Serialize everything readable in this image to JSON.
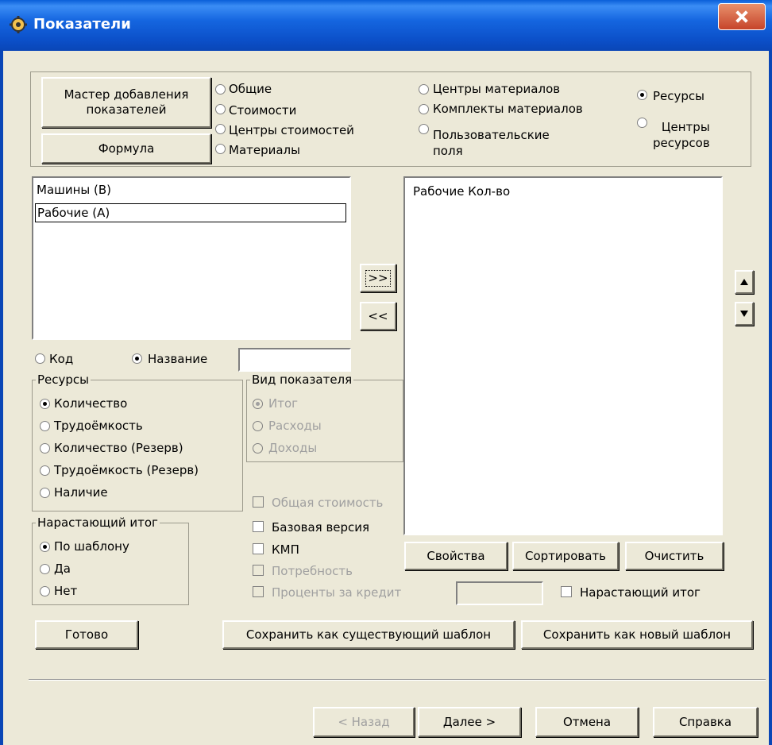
{
  "window": {
    "title": "Показатели"
  },
  "top": {
    "wizard_button": "Мастер добавления\nпоказателей",
    "formula_button": "Формула",
    "categories": [
      {
        "label": "Общие",
        "selected": false
      },
      {
        "label": "Стоимости",
        "selected": false
      },
      {
        "label": "Центры стоимостей",
        "selected": false
      },
      {
        "label": "Материалы",
        "selected": false
      },
      {
        "label": "Центры материалов",
        "selected": false
      },
      {
        "label": "Комплекты материалов",
        "selected": false
      },
      {
        "label": "Пользовательские\nполя",
        "selected": false
      },
      {
        "label": "Ресурсы",
        "selected": true
      },
      {
        "label": "Центры\nресурсов",
        "selected": false
      }
    ]
  },
  "left_list": {
    "items": [
      "Машины   (B)",
      "Рабочие   (A)"
    ]
  },
  "move_buttons": {
    "add": ">>",
    "remove": "<<"
  },
  "right_list": {
    "items": [
      "Рабочие Кол-во"
    ]
  },
  "sort": {
    "code_label": "Код",
    "name_label": "Название",
    "selected": "Название",
    "filter_value": ""
  },
  "resources_group": {
    "title": "Ресурсы",
    "options": [
      "Количество",
      "Трудоёмкость",
      "Количество (Резерв)",
      "Трудоёмкость (Резерв)",
      "Наличие"
    ],
    "selected": "Количество"
  },
  "indicator_group": {
    "title": "Вид показателя",
    "options": [
      "Итог",
      "Расходы",
      "Доходы"
    ],
    "selected": "Итог"
  },
  "cumulative_group": {
    "title": "Нарастающий итог",
    "options": [
      "По шаблону",
      "Да",
      "Нет"
    ],
    "selected": "По шаблону"
  },
  "checks": [
    {
      "label": "Общая стоимость",
      "enabled": false,
      "checked": false
    },
    {
      "label": "Базовая версия",
      "enabled": true,
      "checked": false
    },
    {
      "label": "КМП",
      "enabled": true,
      "checked": false
    },
    {
      "label": "Потребность",
      "enabled": false,
      "checked": false
    },
    {
      "label": "Проценты за кредит",
      "enabled": false,
      "checked": false
    }
  ],
  "right_buttons": {
    "properties": "Свойства",
    "sort": "Сортировать",
    "clear": "Очистить"
  },
  "cumulative_total_check": {
    "label": "Нарастающий итог",
    "checked": false
  },
  "template_buttons": {
    "done": "Готово",
    "save_existing": "Сохранить как существующий шаблон",
    "save_new": "Сохранить как новый шаблон"
  },
  "wizard_nav": {
    "back": "< Назад",
    "next": "Далее >",
    "cancel": "Отмена",
    "help": "Справка"
  }
}
